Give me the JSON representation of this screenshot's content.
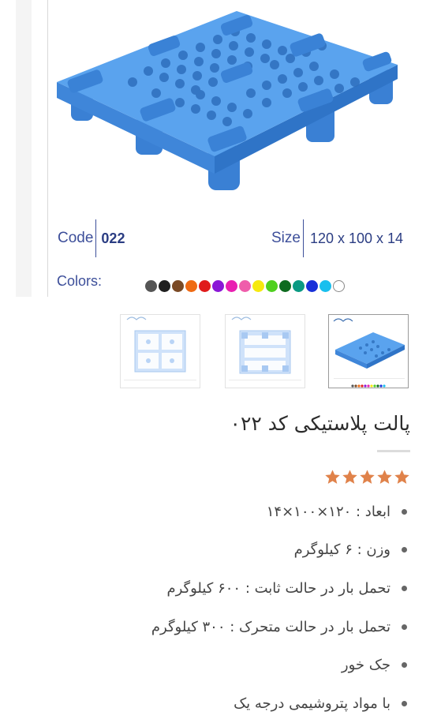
{
  "product_image": {
    "code_label": "Code",
    "code_value": "022",
    "size_label": "Size",
    "size_value": "120 x 100 x 14",
    "colors_label": "Colors:",
    "color_swatches": [
      "#555555",
      "#1f1f1f",
      "#7a4a25",
      "#ef6a13",
      "#e01b1b",
      "#8b17d6",
      "#e91fb1",
      "#ef5dab",
      "#f6e90f",
      "#4fd01f",
      "#0e6b1f",
      "#0a9a82",
      "#1730d8",
      "#19bfee",
      "#ffffff"
    ],
    "pallet_color": "#4a93e6"
  },
  "thumbnails": [
    {
      "name": "top-view",
      "active": false
    },
    {
      "name": "bottom-view",
      "active": false
    },
    {
      "name": "perspective-view",
      "active": true
    }
  ],
  "product": {
    "title": "پالت پلاستیکی کد ۰۲۲",
    "rating": 5,
    "star_color": "#e0824a",
    "features": [
      "ابعاد : ۱۲۰×۱۰۰×۱۴",
      "وزن : ۶ کیلوگرم",
      "تحمل بار در حالت ثابت : ۶۰۰ کیلوگرم",
      "تحمل بار در حالت متحرک : ۳۰۰ کیلوگرم",
      "جک خور",
      "با مواد پتروشیمی درجه یک"
    ]
  }
}
